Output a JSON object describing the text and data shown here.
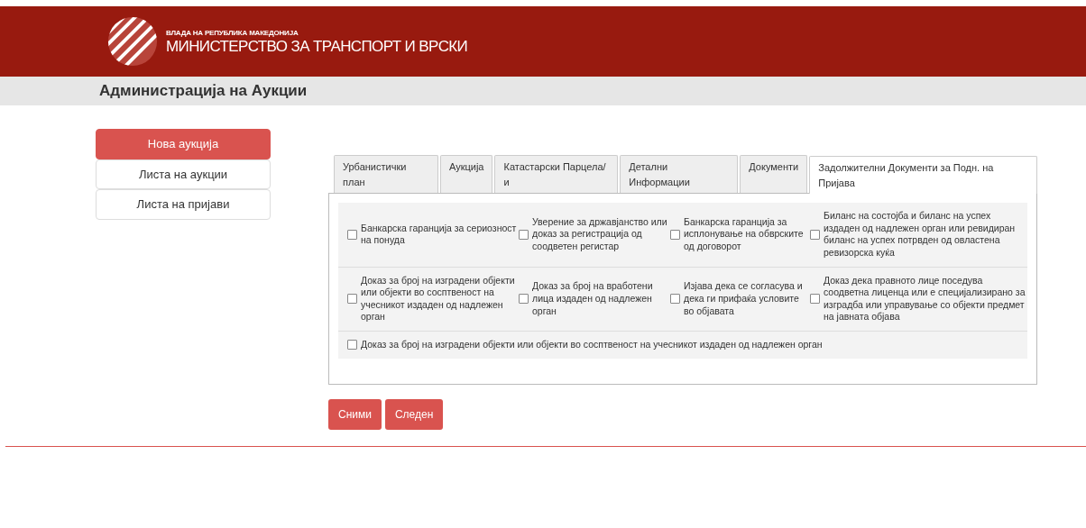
{
  "header": {
    "subtitle": "ВЛАДА НА РЕПУБЛИКА МАКЕДОНИЈА",
    "title": "МИНИСТЕРСТВО ЗА ТРАНСПОРТ И ВРСКИ"
  },
  "page_title": "Администрација на Аукции",
  "sidebar": {
    "items": [
      {
        "label": "Нова аукција",
        "selected": true
      },
      {
        "label": "Листа на аукции",
        "selected": false
      },
      {
        "label": "Листа на пријави",
        "selected": false
      }
    ]
  },
  "tabs": [
    {
      "label": "Урбанистички план",
      "selected": false
    },
    {
      "label": "Аукција",
      "selected": false
    },
    {
      "label": "Катастарски Парцела/и",
      "selected": false
    },
    {
      "label": "Детални Информации",
      "selected": false
    },
    {
      "label": "Документи",
      "selected": false
    },
    {
      "label": "Задолжителни Документи за Подн. на Пријава",
      "selected": true
    }
  ],
  "documents": [
    [
      {
        "label": "Банкарска гаранција за сериозност на понуда",
        "checked": false
      },
      {
        "label": "Уверение за државјанство или доказ за регистрација од соодветен регистар",
        "checked": false
      },
      {
        "label": "Банкарска гаранција за исплонување на обврските од договорот",
        "checked": false
      },
      {
        "label": "Биланс на состојба и биланс на успех издаден од надлежен орган или ревидиран биланс на успех потрвден од овластена ревизорска куќа",
        "checked": false
      }
    ],
    [
      {
        "label": "Доказ за број на изградени објекти или објекти во сосптвеност на учесникот издаден од надлежен орган",
        "checked": false
      },
      {
        "label": "Доказ за број на вработени лица издаден од надлежен орган",
        "checked": false
      },
      {
        "label": "Изјава дека се согласува и дека ги прифаќа условите во објавата",
        "checked": false
      },
      {
        "label": "Доказ дека правното лице поседува соодветна лиценца или е специјализирано за изградба или управување со објекти предмет на јавната објава",
        "checked": false
      }
    ],
    [
      {
        "label": "Доказ за број на изградени објекти или објекти во сосптвеност на учесникот издаден од надлежен орган",
        "checked": false
      }
    ]
  ],
  "buttons": [
    "Сними",
    "Следен"
  ]
}
